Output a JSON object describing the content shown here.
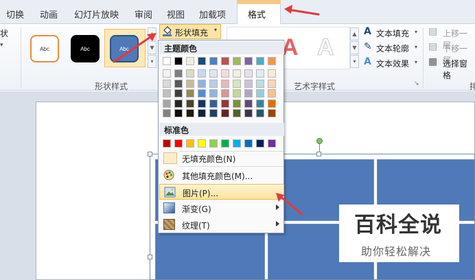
{
  "tabs": [
    "切换",
    "动画",
    "幻灯片放映",
    "审阅",
    "视图",
    "加载项",
    "格式"
  ],
  "left_cut": {
    "label1": "状",
    "label2": "▾"
  },
  "shape_styles": {
    "group_label": "形状样式",
    "preset_text": "Abc",
    "presets": [
      {
        "style": "orange-outline",
        "fill": "#ffffff",
        "border": "#e88d3a",
        "text_color": "#333333"
      },
      {
        "style": "black",
        "fill": "#000000",
        "border": "#000000",
        "text_color": "#ffffff"
      },
      {
        "style": "blue-selected",
        "fill": "#4f79b8",
        "border": "#30507f",
        "text_color": "#ffffff"
      }
    ]
  },
  "fill_button": {
    "label": "形状填充",
    "caret": "▾",
    "icon": "paint-bucket-icon"
  },
  "wordart": {
    "group_label": "艺术字样式",
    "letters": [
      "A",
      "A"
    ],
    "text_fill": "文本填充",
    "text_outline": "文本轮廓",
    "text_effects": "文本效果",
    "expand_icon": "↘"
  },
  "arrange": {
    "bring_forward": "上移一层",
    "send_backward": "下移一层",
    "selection_pane": "选择窗格",
    "group_label_cut": "排"
  },
  "dropdown": {
    "theme_colors_label": "主题颜色",
    "standard_colors_label": "标准色",
    "theme_columns": [
      [
        "#ffffff",
        "#f2f2f2",
        "#d9d9d9",
        "#bfbfbf",
        "#a6a6a6",
        "#808080"
      ],
      [
        "#000000",
        "#7f7f7f",
        "#595959",
        "#404040",
        "#262626",
        "#0d0d0d"
      ],
      [
        "#eeece1",
        "#ddd9c3",
        "#c4bd97",
        "#948a54",
        "#4a452a",
        "#1e1c11"
      ],
      [
        "#1f497d",
        "#c6d9f1",
        "#8db3e2",
        "#548dd4",
        "#17375e",
        "#0f243e"
      ],
      [
        "#4f81bd",
        "#dce6f2",
        "#b9cde5",
        "#95b3d7",
        "#376092",
        "#244062"
      ],
      [
        "#c0504d",
        "#f2dcdb",
        "#e6b9b8",
        "#d99694",
        "#953735",
        "#632523"
      ],
      [
        "#9bbb59",
        "#ebf1de",
        "#d7e4bd",
        "#c3d69b",
        "#77933c",
        "#4f6228"
      ],
      [
        "#8064a2",
        "#e6e0ec",
        "#ccc1da",
        "#b3a2c7",
        "#604a7b",
        "#403152"
      ],
      [
        "#4bacc6",
        "#dbeef4",
        "#b7dee8",
        "#93cddd",
        "#31859c",
        "#215968"
      ],
      [
        "#f79646",
        "#fdeada",
        "#fcd5b5",
        "#fac090",
        "#e46c0a",
        "#984807"
      ]
    ],
    "standard": [
      "#c00000",
      "#ff0000",
      "#ffc000",
      "#ffff00",
      "#92d050",
      "#00b050",
      "#00b0f0",
      "#0070c0",
      "#002060",
      "#7030a0"
    ],
    "items": {
      "no_fill": "无填充颜色(N)",
      "more_colors": "其他填充颜色(M)...",
      "picture": "图片(P)...",
      "gradient": "渐变(G)",
      "texture": "纹理(T)"
    }
  },
  "watermark": {
    "title": "百科全说",
    "subtitle": "助你轻松解决"
  },
  "colors": {
    "accent_arrow": "#e23a3a",
    "slide_tile": "#4f79b8",
    "highlight": "#fde39a"
  }
}
